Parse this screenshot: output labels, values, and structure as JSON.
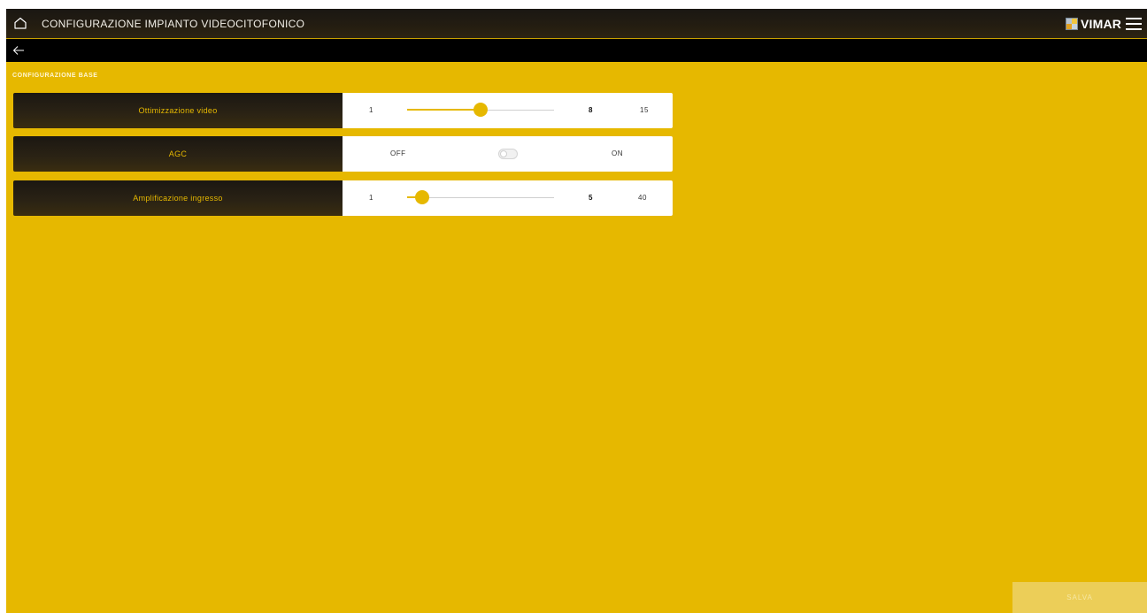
{
  "header": {
    "title": "CONFIGURAZIONE IMPIANTO VIDEOCITOFONICO",
    "brand": "VIMAR",
    "icons": [
      "home-icon",
      "menu-icon"
    ]
  },
  "navigation": {
    "back_icon": "arrow-left-icon"
  },
  "section": {
    "title": "CONFIGURAZIONE BASE"
  },
  "settings": [
    {
      "label": "Ottimizzazione video",
      "type": "slider",
      "min": "1",
      "max": "15",
      "value": "8",
      "value_fraction": 0.5
    },
    {
      "label": "AGC",
      "type": "toggle",
      "off_label": "OFF",
      "on_label": "ON",
      "state": "off"
    },
    {
      "label": "Amplificazione ingresso",
      "type": "slider",
      "min": "1",
      "max": "40",
      "value": "5",
      "value_fraction": 0.1
    }
  ],
  "footer": {
    "save_label": "SALVA"
  },
  "colors": {
    "accent": "#e6b800",
    "header_dark": "#1f1a12",
    "save_disabled": "#ecce58"
  }
}
